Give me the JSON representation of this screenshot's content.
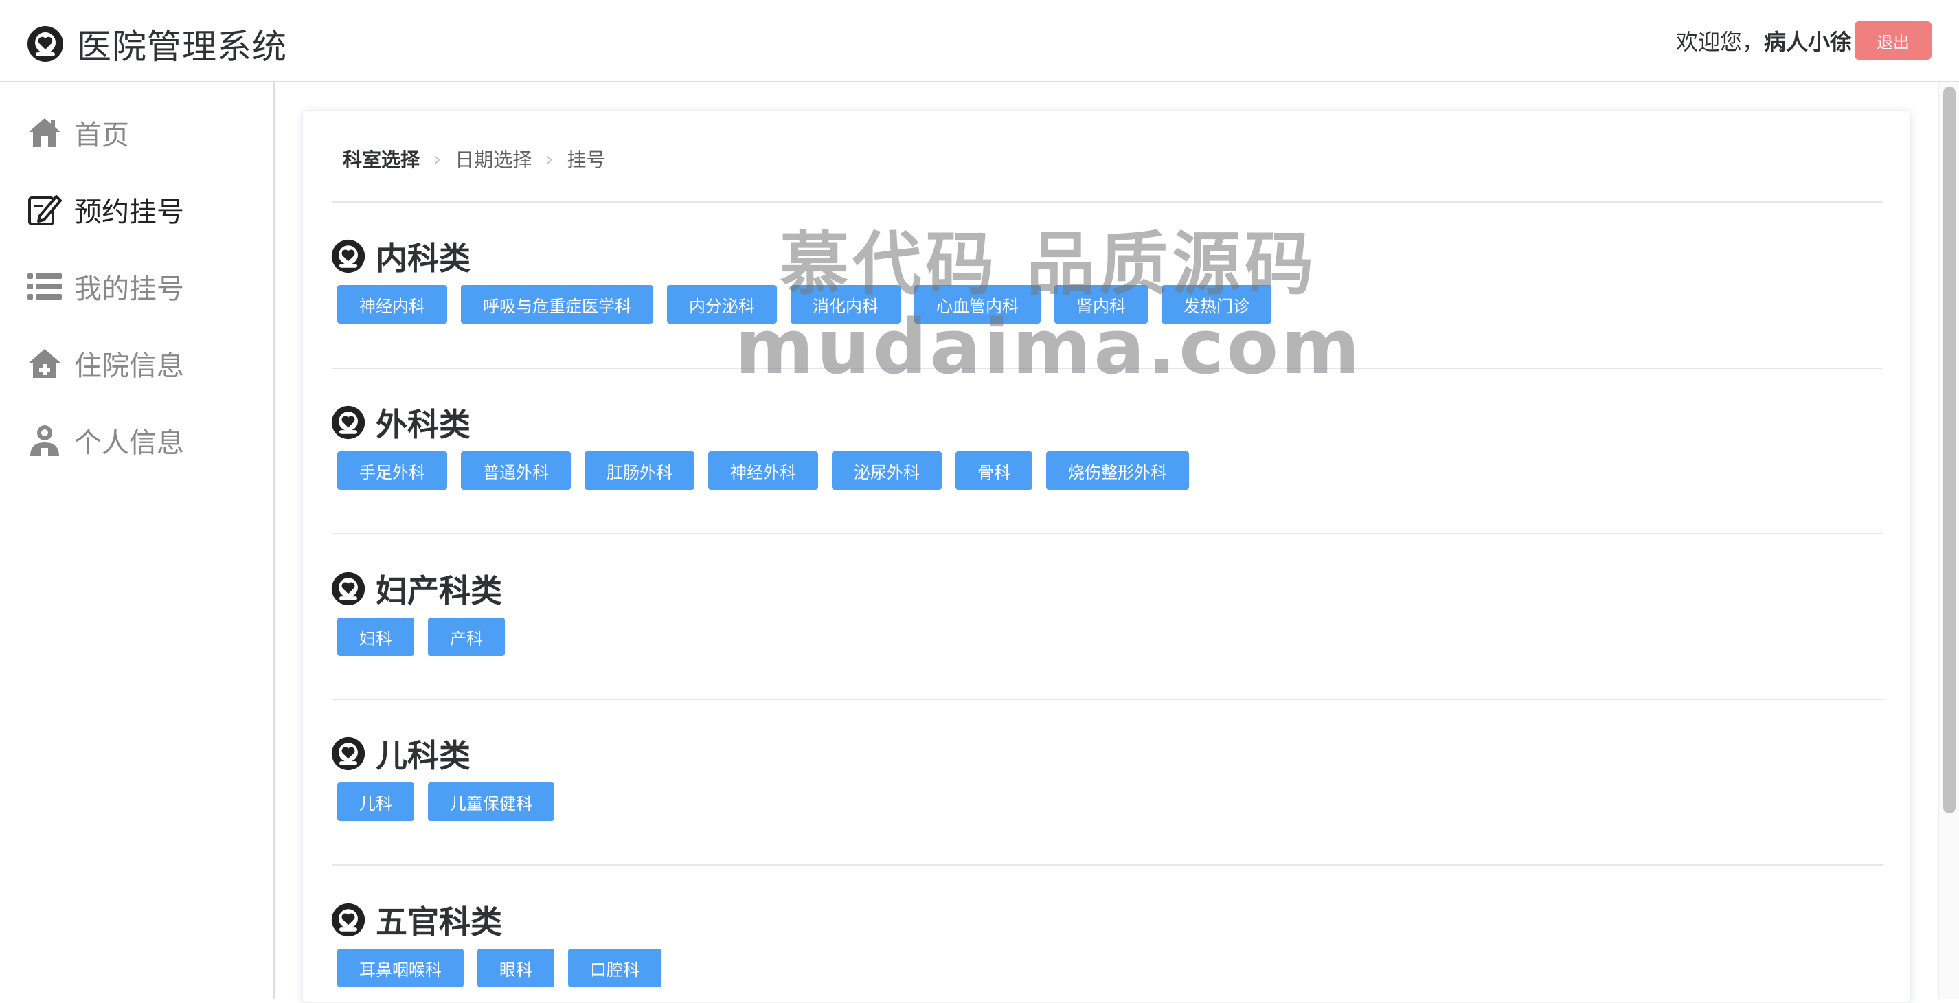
{
  "header": {
    "title": "医院管理系统",
    "welcome": "欢迎您，",
    "user_name": "病人小徐",
    "logout_label": "退出"
  },
  "sidebar": {
    "items": [
      {
        "label": "首页",
        "icon": "home-icon"
      },
      {
        "label": "预约挂号",
        "icon": "edit-icon",
        "active": true
      },
      {
        "label": "我的挂号",
        "icon": "list-icon"
      },
      {
        "label": "住院信息",
        "icon": "hospital-icon"
      },
      {
        "label": "个人信息",
        "icon": "user-icon"
      }
    ]
  },
  "steps": [
    "科室选择",
    "日期选择",
    "挂号"
  ],
  "categories": [
    {
      "title": "内科类",
      "departments": [
        "神经内科",
        "呼吸与危重症医学科",
        "内分泌科",
        "消化内科",
        "心血管内科",
        "肾内科",
        "发热门诊"
      ]
    },
    {
      "title": "外科类",
      "departments": [
        "手足外科",
        "普通外科",
        "肛肠外科",
        "神经外科",
        "泌尿外科",
        "骨科",
        "烧伤整形外科"
      ]
    },
    {
      "title": "妇产科类",
      "departments": [
        "妇科",
        "产科"
      ]
    },
    {
      "title": "儿科类",
      "departments": [
        "儿科",
        "儿童保健科"
      ]
    },
    {
      "title": "五官科类",
      "departments": [
        "耳鼻咽喉科",
        "眼科",
        "口腔科"
      ]
    }
  ],
  "watermark": {
    "line1": "慕代码 品质源码",
    "line2": "mudaima.com"
  },
  "colors": {
    "primary": "#4d9ef5",
    "danger": "#f07f7f",
    "text": "#303133",
    "muted": "#888888"
  }
}
